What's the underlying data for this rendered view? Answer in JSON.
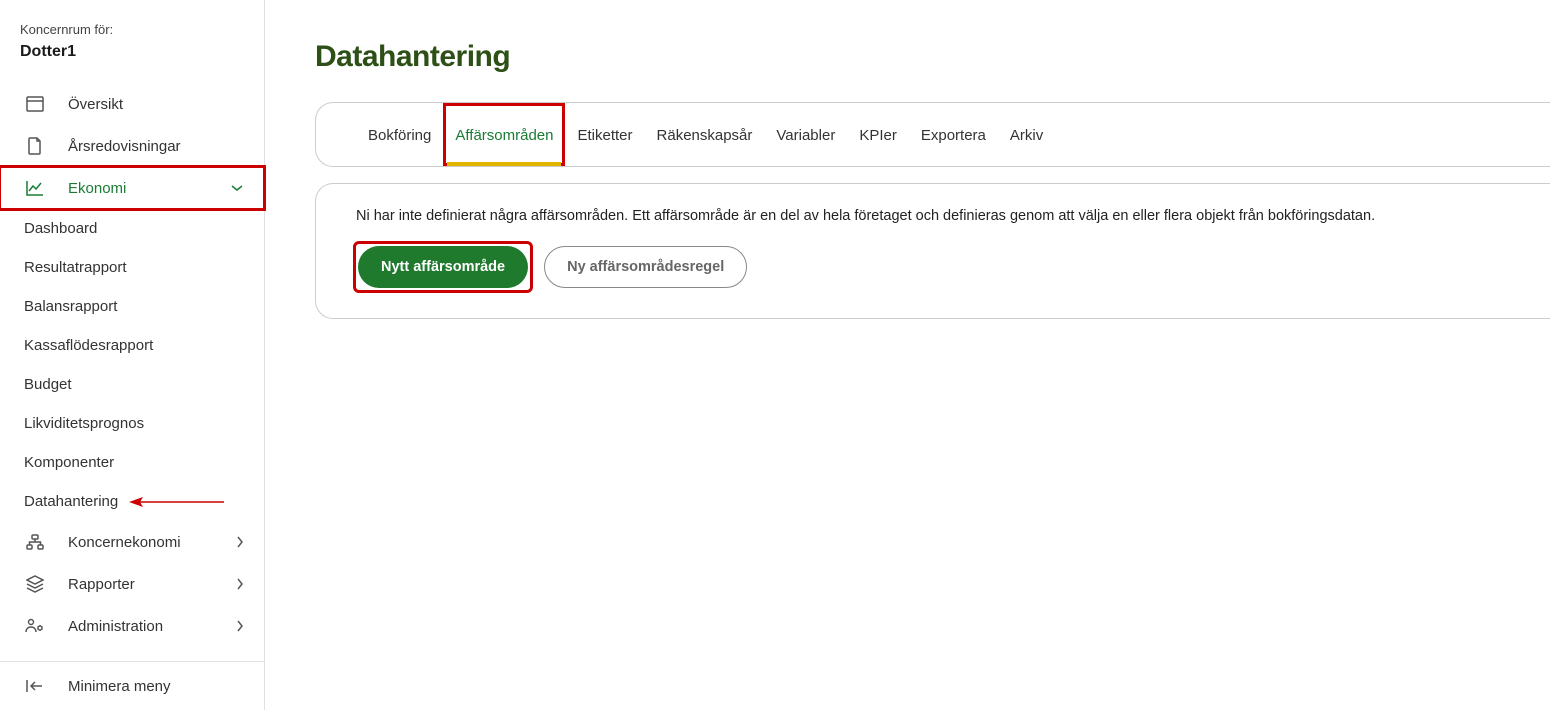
{
  "sidebar": {
    "header_label": "Koncernrum för:",
    "company": "Dotter1",
    "items": [
      {
        "label": "Översikt"
      },
      {
        "label": "Årsredovisningar"
      },
      {
        "label": "Ekonomi"
      },
      {
        "label": "Koncernekonomi"
      },
      {
        "label": "Rapporter"
      },
      {
        "label": "Administration"
      }
    ],
    "ekonomi_sub": [
      "Dashboard",
      "Resultatrapport",
      "Balansrapport",
      "Kassaflödesrapport",
      "Budget",
      "Likviditetsprognos",
      "Komponenter",
      "Datahantering"
    ],
    "footer": "Minimera meny"
  },
  "page": {
    "title": "Datahantering",
    "tabs": [
      "Bokföring",
      "Affärsområden",
      "Etiketter",
      "Räkenskapsår",
      "Variabler",
      "KPIer",
      "Exportera",
      "Arkiv"
    ],
    "empty_text": "Ni har inte definierat några affärsområden. Ett affärsområde är en del av hela företaget och definieras genom att välja en eller flera objekt från bokföringsdatan.",
    "primary_button": "Nytt affärsområde",
    "secondary_button": "Ny affärsområdesregel"
  }
}
